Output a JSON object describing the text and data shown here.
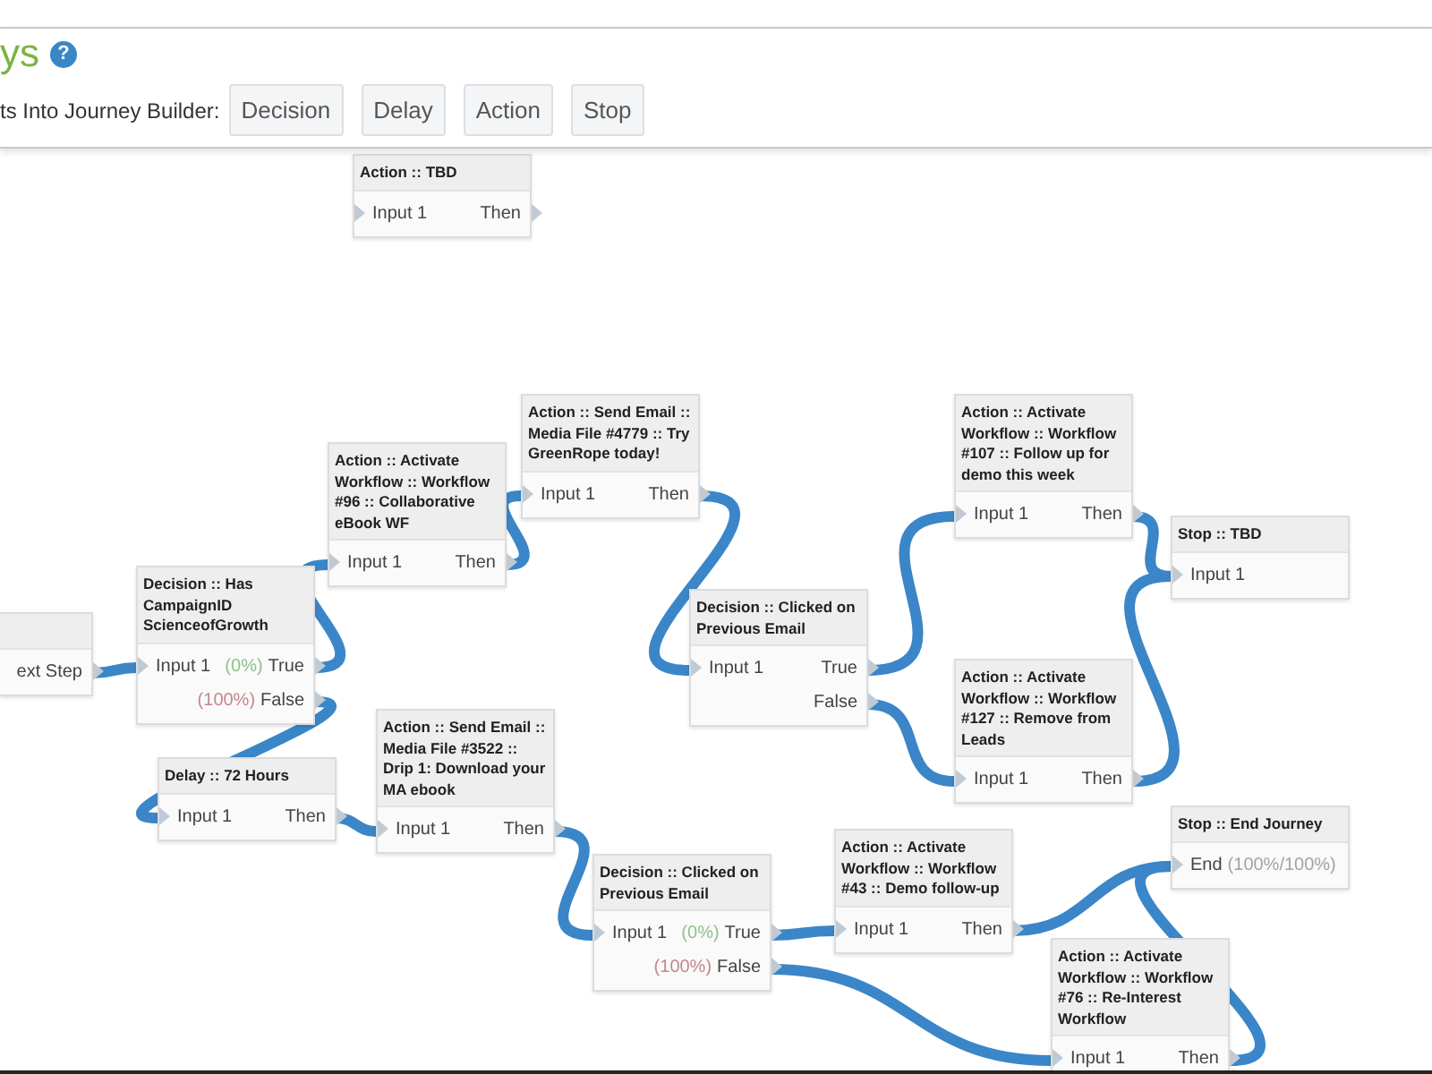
{
  "header": {
    "title": "ys",
    "help": "?",
    "label": "ts Into Journey Builder:",
    "buttons": [
      "Decision",
      "Delay",
      "Action",
      "Stop"
    ]
  },
  "nodes": [
    {
      "title": "Action :: TBD",
      "inputs": [
        {
          "label": "Input 1"
        }
      ],
      "outputs": [
        {
          "label": "Then"
        }
      ]
    },
    {
      "outputs": [
        {
          "label": "ext Step"
        }
      ]
    },
    {
      "title": "Decision :: Has CampaignID ScienceofGrowth",
      "inputs": [
        {
          "label": "Input 1"
        }
      ],
      "outputs": [
        {
          "stat": "(0%)",
          "color": "#8fc18c",
          "label": "True"
        },
        {
          "stat": "(100%)",
          "color": "#c4868c",
          "label": "False"
        }
      ]
    },
    {
      "title": "Action :: Activate Workflow :: Workflow #96 :: Collaborative eBook WF",
      "inputs": [
        {
          "label": "Input 1"
        }
      ],
      "outputs": [
        {
          "label": "Then"
        }
      ]
    },
    {
      "title": "Action :: Send Email :: Media File #4779 :: Try GreenRope today!",
      "inputs": [
        {
          "label": "Input 1"
        }
      ],
      "outputs": [
        {
          "label": "Then"
        }
      ]
    },
    {
      "title": "Decision :: Clicked on Previous Email",
      "inputs": [
        {
          "label": "Input 1"
        }
      ],
      "outputs": [
        {
          "label": "True"
        },
        {
          "label": "False"
        }
      ]
    },
    {
      "title": "Action :: Activate Workflow :: Workflow #107 :: Follow up for demo this week",
      "inputs": [
        {
          "label": "Input 1"
        }
      ],
      "outputs": [
        {
          "label": "Then"
        }
      ]
    },
    {
      "title": "Stop :: TBD",
      "inputs": [
        {
          "label": "Input 1"
        }
      ]
    },
    {
      "title": "Action :: Activate Workflow :: Workflow #127 :: Remove from Leads",
      "inputs": [
        {
          "label": "Input 1"
        }
      ],
      "outputs": [
        {
          "label": "Then"
        }
      ]
    },
    {
      "title": "Delay :: 72 Hours",
      "inputs": [
        {
          "label": "Input 1"
        }
      ],
      "outputs": [
        {
          "label": "Then"
        }
      ]
    },
    {
      "title": "Action :: Send Email :: Media File #3522 :: Drip 1: Download your MA ebook",
      "inputs": [
        {
          "label": "Input 1"
        }
      ],
      "outputs": [
        {
          "label": "Then"
        }
      ]
    },
    {
      "title": "Decision :: Clicked on Previous Email",
      "inputs": [
        {
          "label": "Input 1"
        }
      ],
      "outputs": [
        {
          "stat": "(0%)",
          "color": "#8fc18c",
          "label": "True"
        },
        {
          "stat": "(100%)",
          "color": "#c4868c",
          "label": "False"
        }
      ]
    },
    {
      "title": "Action :: Activate Workflow :: Workflow #43 :: Demo follow-up",
      "inputs": [
        {
          "label": "Input 1"
        }
      ],
      "outputs": [
        {
          "label": "Then"
        }
      ]
    },
    {
      "title": "Stop :: End Journey",
      "inputs": [
        {
          "label": "End",
          "stat": "(100%/100%)",
          "color": "#a3a3a3"
        }
      ]
    },
    {
      "title": "Action :: Activate Workflow :: Workflow #76 :: Re-Interest Workflow",
      "inputs": [
        {
          "label": "Input 1"
        }
      ],
      "outputs": [
        {
          "label": "Then"
        }
      ]
    }
  ]
}
